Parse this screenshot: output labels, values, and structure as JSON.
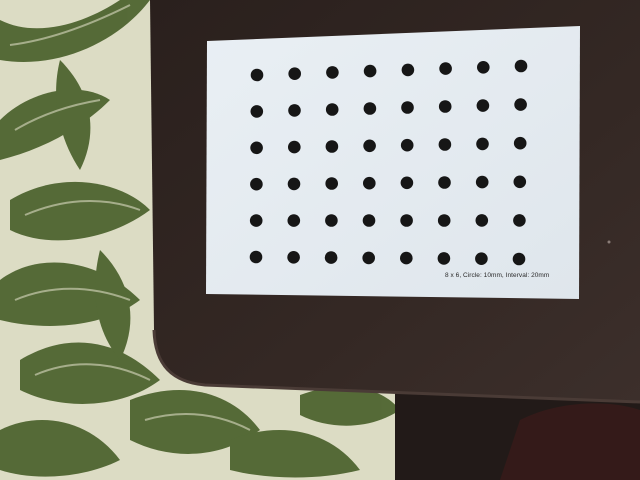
{
  "photo": {
    "subject": "circle-grid-calibration-target",
    "target": {
      "columns": 8,
      "rows": 6,
      "caption": "8 x 6, Circle: 10mm, Interval: 20mm"
    },
    "colors": {
      "carpet_light": "#dcdcc4",
      "carpet_green": "#4e6430",
      "table": "#2f2420",
      "table_edge": "#3d2f2a",
      "paper": "#e6edf2",
      "dot": "#161616",
      "floor_shadow": "#221a18"
    }
  }
}
